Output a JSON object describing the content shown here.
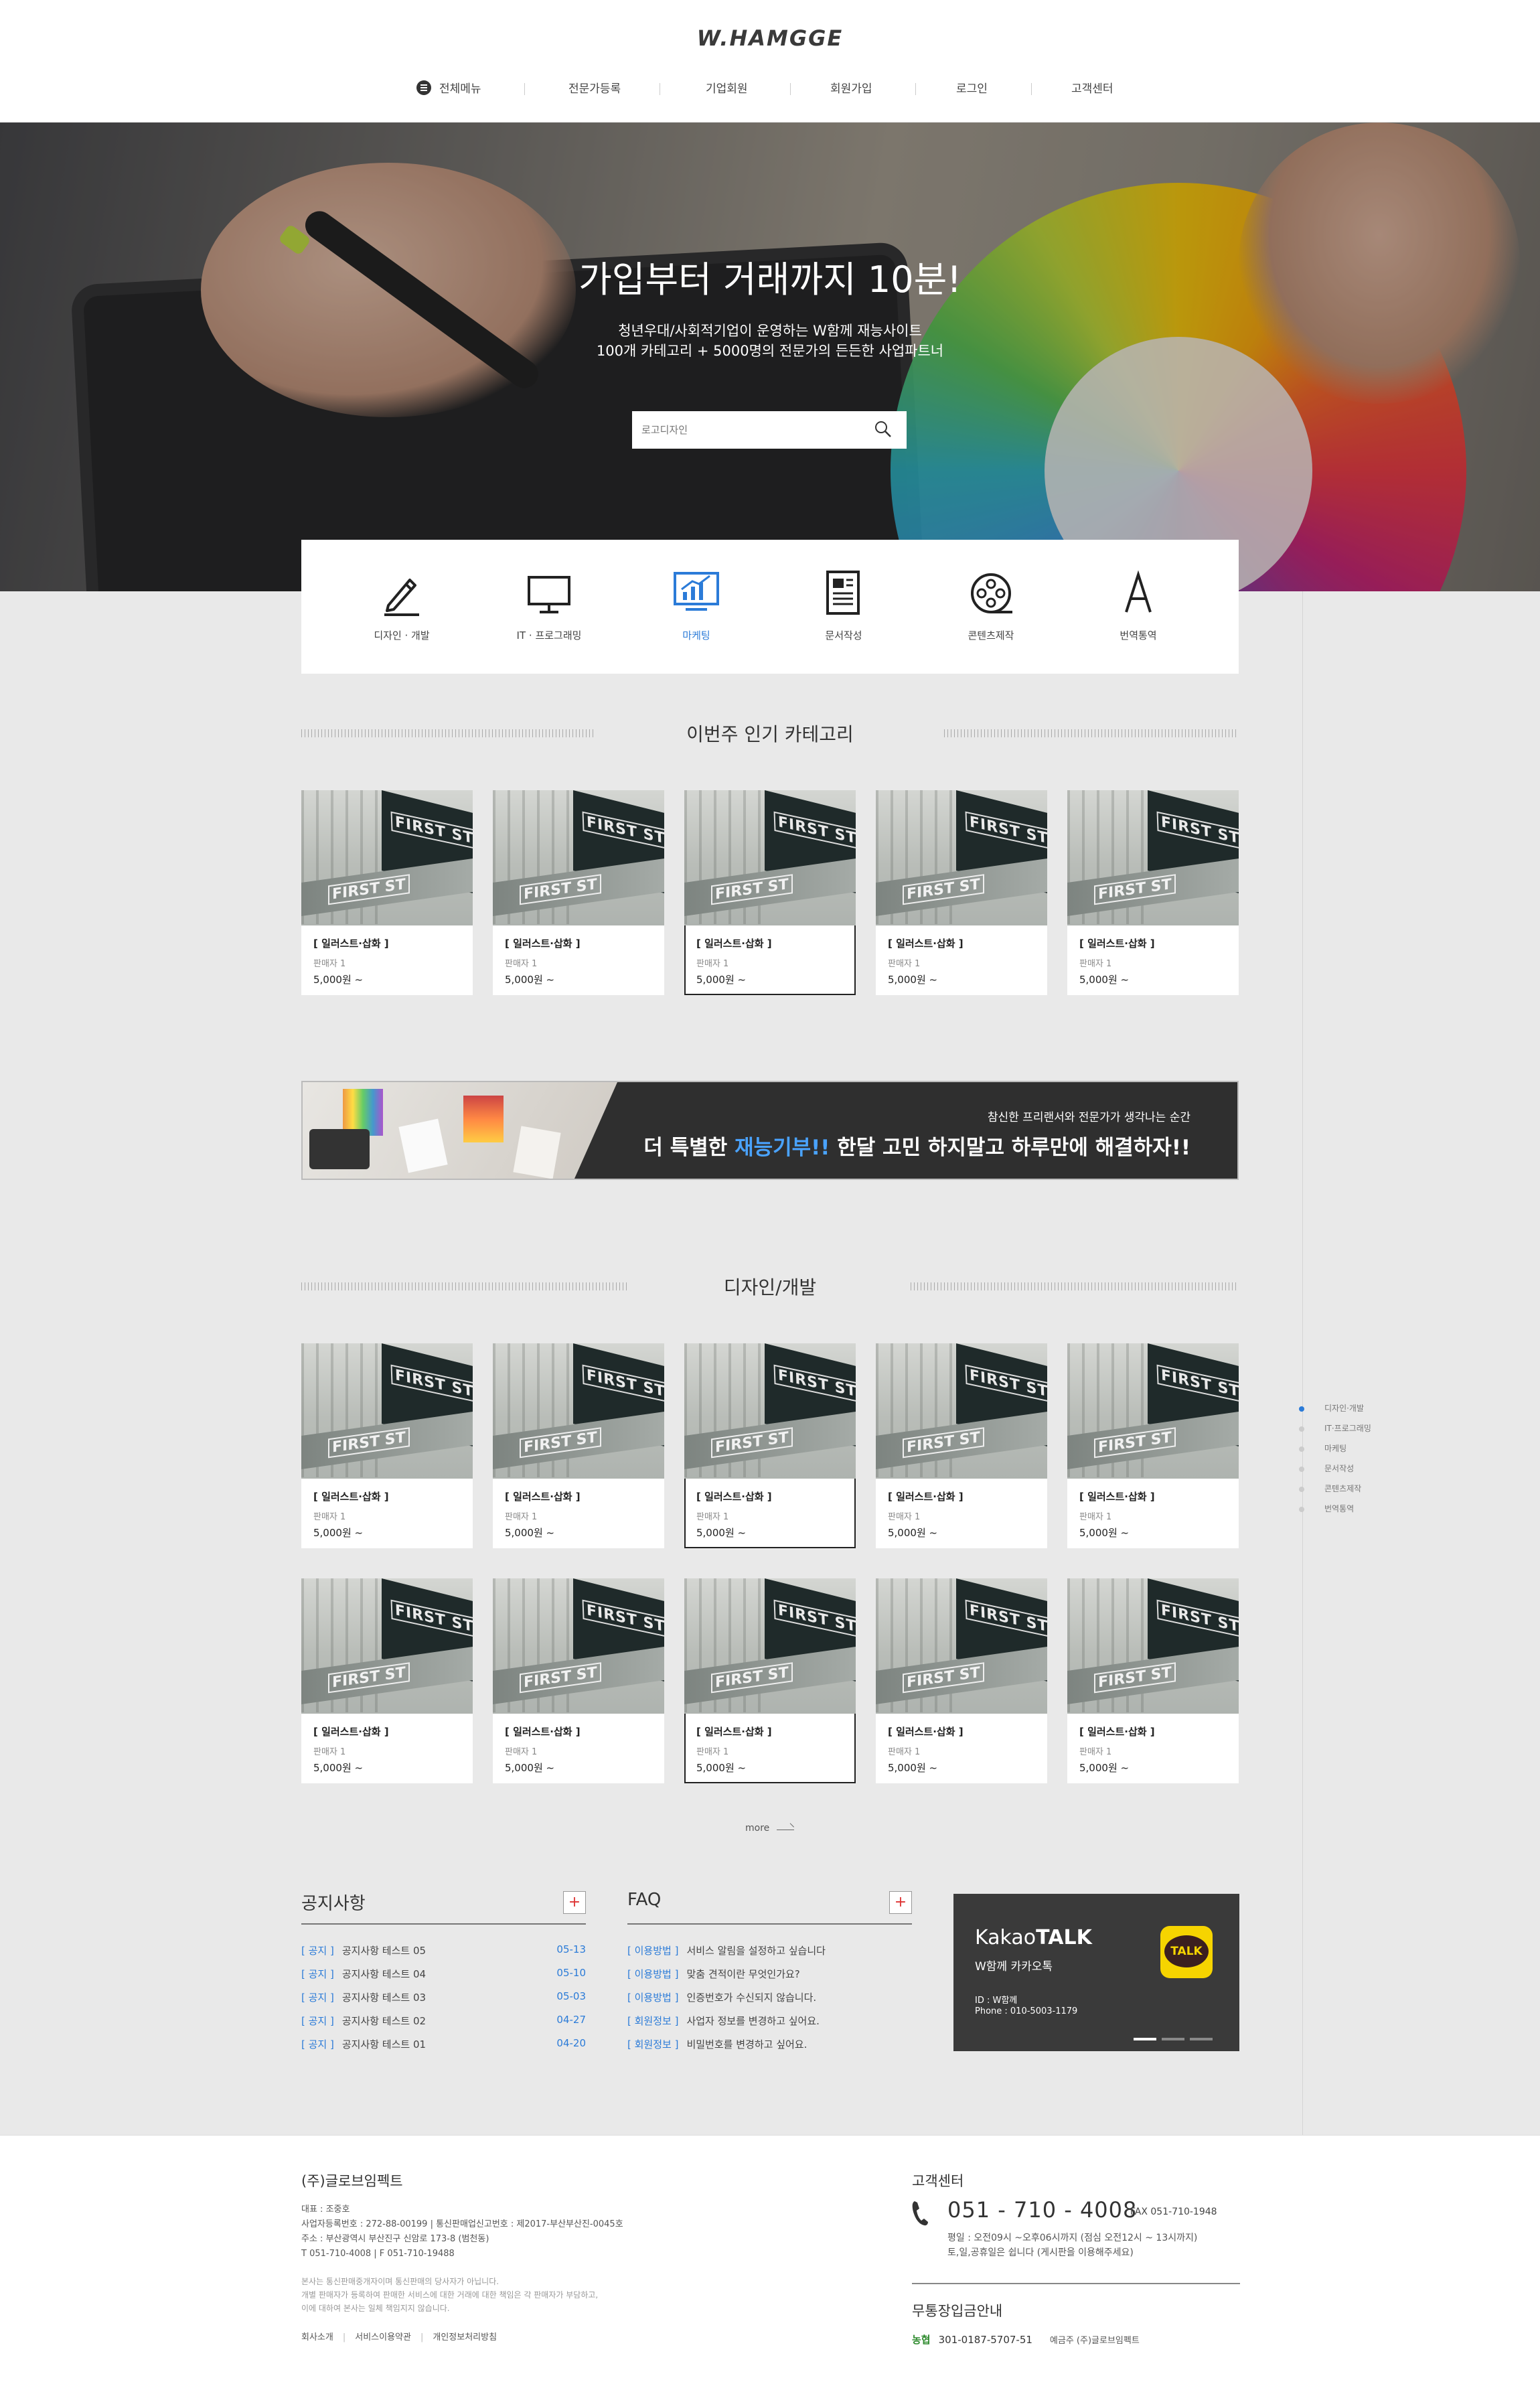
{
  "header": {
    "logo": "W.HAMGGE",
    "nav": [
      "전체메뉴",
      "전문가등록",
      "기업회원",
      "회원가입",
      "로그인",
      "고객센터"
    ]
  },
  "hero": {
    "title": "가입부터 거래까지 10분!",
    "sub1": "청년우대/사회적기업이 운영하는 W함께 재능사이트",
    "sub2": "100개 카테고리 + 5000명의 전문가의 든든한 사업파트너",
    "search_placeholder": "로고디자인"
  },
  "categories": [
    {
      "label": "디자인 · 개발",
      "icon": "pencil-icon"
    },
    {
      "label": "IT · 프로그래밍",
      "icon": "monitor-icon"
    },
    {
      "label": "마케팅",
      "icon": "chart-monitor-icon"
    },
    {
      "label": "문서작성",
      "icon": "document-icon"
    },
    {
      "label": "콘텐츠제작",
      "icon": "film-reel-icon"
    },
    {
      "label": "번역통역",
      "icon": "letter-a-icon"
    }
  ],
  "popular": {
    "title": "이번주 인기 카테고리",
    "cards": [
      {
        "title": "[ 일러스트·삽화 ]",
        "sub": "판매자 1",
        "price": "5,000원 ~"
      },
      {
        "title": "[ 일러스트·삽화 ]",
        "sub": "판매자 1",
        "price": "5,000원 ~"
      },
      {
        "title": "[ 일러스트·삽화 ]",
        "sub": "판매자 1",
        "price": "5,000원 ~"
      },
      {
        "title": "[ 일러스트·삽화 ]",
        "sub": "판매자 1",
        "price": "5,000원 ~"
      },
      {
        "title": "[ 일러스트·삽화 ]",
        "sub": "판매자 1",
        "price": "5,000원 ~"
      }
    ]
  },
  "banner": {
    "small": "참신한 프리랜서와 전문가가 생각나는 순간",
    "big_pre": "더 특별한 ",
    "big_hl": "재능기부!!",
    "big_post": " 한달 고민 하지말고 하루만에 해결하자!!"
  },
  "design": {
    "title": "디자인/개발",
    "row1": [
      {
        "title": "[ 일러스트·삽화 ]",
        "sub": "판매자 1",
        "price": "5,000원 ~"
      },
      {
        "title": "[ 일러스트·삽화 ]",
        "sub": "판매자 1",
        "price": "5,000원 ~"
      },
      {
        "title": "[ 일러스트·삽화 ]",
        "sub": "판매자 1",
        "price": "5,000원 ~"
      },
      {
        "title": "[ 일러스트·삽화 ]",
        "sub": "판매자 1",
        "price": "5,000원 ~"
      },
      {
        "title": "[ 일러스트·삽화 ]",
        "sub": "판매자 1",
        "price": "5,000원 ~"
      }
    ],
    "row2": [
      {
        "title": "[ 일러스트·삽화 ]",
        "sub": "판매자 1",
        "price": "5,000원 ~"
      },
      {
        "title": "[ 일러스트·삽화 ]",
        "sub": "판매자 1",
        "price": "5,000원 ~"
      },
      {
        "title": "[ 일러스트·삽화 ]",
        "sub": "판매자 1",
        "price": "5,000원 ~"
      },
      {
        "title": "[ 일러스트·삽화 ]",
        "sub": "판매자 1",
        "price": "5,000원 ~"
      },
      {
        "title": "[ 일러스트·삽화 ]",
        "sub": "판매자 1",
        "price": "5,000원 ~"
      }
    ],
    "more": "more"
  },
  "thumb": {
    "sign_top": "FIRST ST",
    "sign_bottom": "FIRST ST"
  },
  "side_nav": [
    "디자인·개발",
    "IT·프로그래밍",
    "마케팅",
    "문서작성",
    "콘텐츠제작",
    "번역통역"
  ],
  "notice": {
    "title": "공지사항",
    "plus": "+",
    "items": [
      {
        "tag": "[ 공지 ]",
        "text": "공지사항 테스트 05",
        "date": "05-13"
      },
      {
        "tag": "[ 공지 ]",
        "text": "공지사항 테스트 04",
        "date": "05-10"
      },
      {
        "tag": "[ 공지 ]",
        "text": "공지사항 테스트 03",
        "date": "05-03"
      },
      {
        "tag": "[ 공지 ]",
        "text": "공지사항 테스트 02",
        "date": "04-27"
      },
      {
        "tag": "[ 공지 ]",
        "text": "공지사항 테스트 01",
        "date": "04-20"
      }
    ]
  },
  "faq": {
    "title": "FAQ",
    "plus": "+",
    "items": [
      {
        "tag": "[ 이용방법 ]",
        "text": "서비스 알림을 설정하고 싶습니다"
      },
      {
        "tag": "[ 이용방법 ]",
        "text": "맞춤 견적이란 무엇인가요?"
      },
      {
        "tag": "[ 이용방법 ]",
        "text": "인증번호가 수신되지 않습니다."
      },
      {
        "tag": "[ 회원정보 ]",
        "text": "사업자 정보를 변경하고 싶어요."
      },
      {
        "tag": "[ 회원정보 ]",
        "text": "비밀번호를 변경하고 싶어요."
      }
    ]
  },
  "kakao": {
    "logo_light": "Kakao",
    "logo_bold": "TALK",
    "name": "W함께 카카오톡",
    "id": "ID : W함께",
    "phone": "Phone : 010-5003-1179",
    "badge": "TALK"
  },
  "footer": {
    "company": "(주)글로브임펙트",
    "info1": "대표 : 조중호",
    "info2": "사업자등록번호 : 272-88-00199   |   통신판매업신고번호 : 제2017-부산부산진-0045호",
    "info3": "주소 : 부산광역시 부산진구 신암로 173-8 (범천동)",
    "info4": "T 051-710-4008   |   F 051-710-19488",
    "warn1": "본사는 통신판매중개자이며 통신판매의 당사자가 아닙니다.",
    "warn2": "개별 판매자가 등록하여 판매한 서비스에 대한 거래에 대한 책임은 각 판매자가 부담하고,",
    "warn3": "이에 대하여 본사는 일체 책임지지 않습니다.",
    "links": [
      "회사소개",
      "서비스이용약관",
      "개인정보처리방침"
    ],
    "cs_title": "고객센터",
    "cs_phone": "051 - 710 - 4008",
    "cs_fax": "FAX 051-710-1948",
    "cs_hours1": "평일 : 오전09시 ~오후06시까지 (점심 오전12시 ~ 13시까지)",
    "cs_hours2": "토,일,공휴일은 쉽니다 (게시판을 이용해주세요)",
    "bank_title": "무통장입금안내",
    "bank_name": "농협",
    "bank_account": "301-0187-5707-51",
    "bank_holder": "예금주 (주)글로브임펙트"
  },
  "colors": {
    "accent": "#2b7bd8",
    "dark": "#333333",
    "kakao_yellow": "#f6d400"
  }
}
